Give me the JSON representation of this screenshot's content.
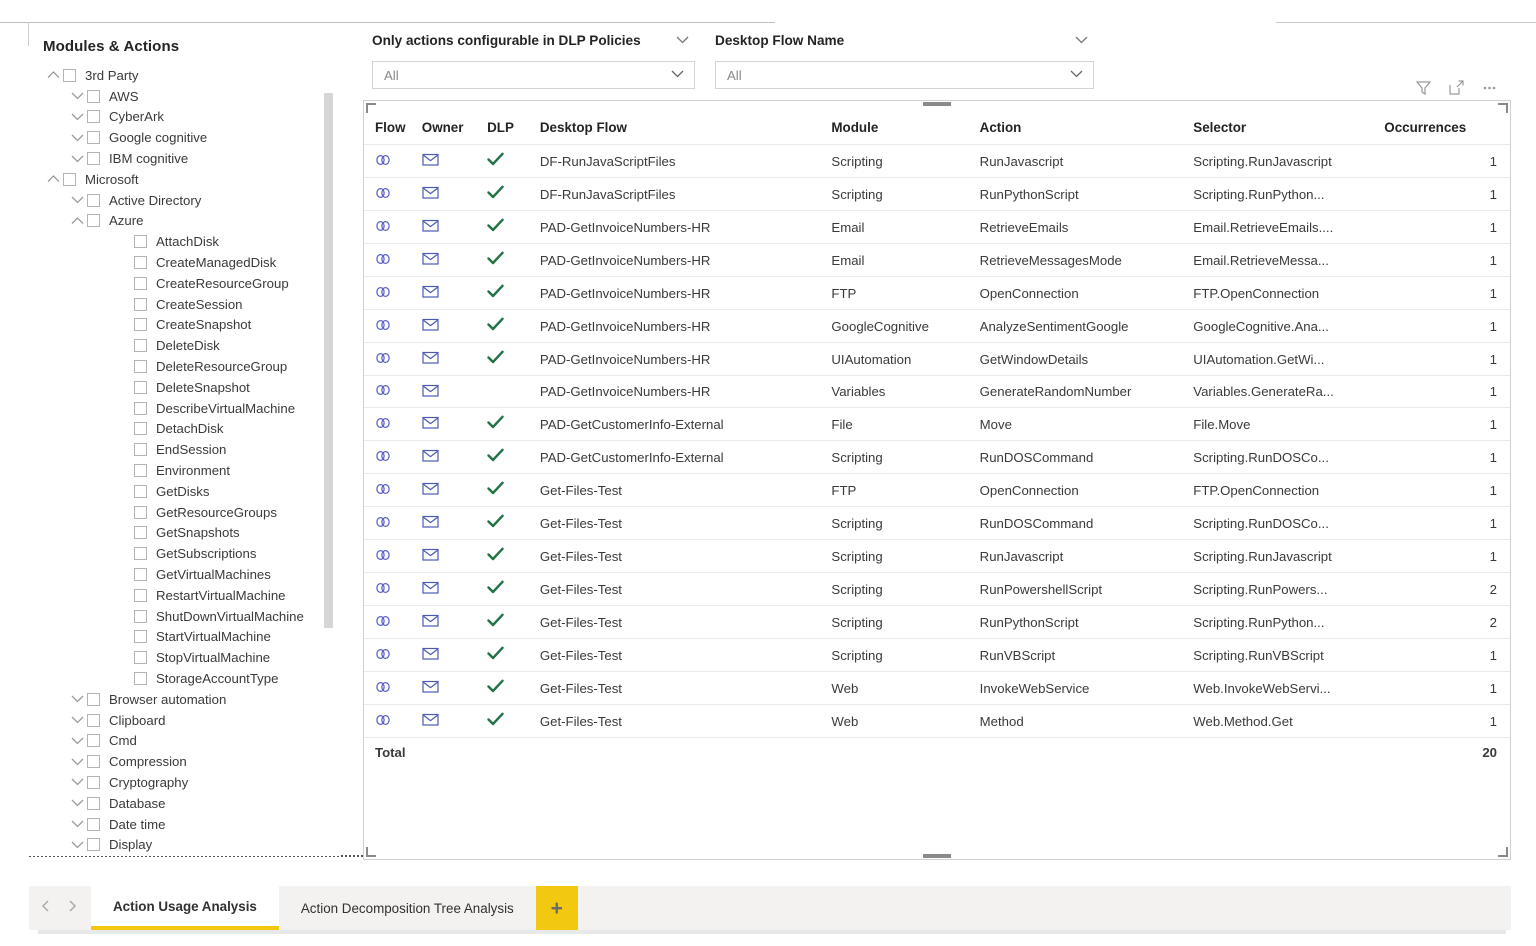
{
  "slicers": {
    "dlp": {
      "title": "Only actions configurable in DLP Policies",
      "value": "All",
      "caret_icon": "chevron-down-icon"
    },
    "flow": {
      "title": "Desktop Flow Name",
      "value": "All",
      "caret_icon": "chevron-down-icon"
    }
  },
  "tree": {
    "title": "Modules & Actions",
    "items": [
      {
        "label": "3rd Party",
        "level": 0,
        "chevron": "chevron-up-icon",
        "checkbox": true
      },
      {
        "label": "AWS",
        "level": 1,
        "chevron": "chevron-down-icon",
        "checkbox": true
      },
      {
        "label": "CyberArk",
        "level": 1,
        "chevron": "chevron-down-icon",
        "checkbox": true
      },
      {
        "label": "Google cognitive",
        "level": 1,
        "chevron": "chevron-down-icon",
        "checkbox": true
      },
      {
        "label": "IBM cognitive",
        "level": 1,
        "chevron": "chevron-down-icon",
        "checkbox": true
      },
      {
        "label": "Microsoft",
        "level": 0,
        "chevron": "chevron-up-icon",
        "checkbox": true
      },
      {
        "label": "Active Directory",
        "level": 1,
        "chevron": "chevron-down-icon",
        "checkbox": true
      },
      {
        "label": "Azure",
        "level": 1,
        "chevron": "chevron-up-icon",
        "checkbox": true
      },
      {
        "label": "AttachDisk",
        "level": 2,
        "chevron": "none",
        "checkbox": true
      },
      {
        "label": "CreateManagedDisk",
        "level": 2,
        "chevron": "none",
        "checkbox": true
      },
      {
        "label": "CreateResourceGroup",
        "level": 2,
        "chevron": "none",
        "checkbox": true
      },
      {
        "label": "CreateSession",
        "level": 2,
        "chevron": "none",
        "checkbox": true
      },
      {
        "label": "CreateSnapshot",
        "level": 2,
        "chevron": "none",
        "checkbox": true
      },
      {
        "label": "DeleteDisk",
        "level": 2,
        "chevron": "none",
        "checkbox": true
      },
      {
        "label": "DeleteResourceGroup",
        "level": 2,
        "chevron": "none",
        "checkbox": true
      },
      {
        "label": "DeleteSnapshot",
        "level": 2,
        "chevron": "none",
        "checkbox": true
      },
      {
        "label": "DescribeVirtualMachine",
        "level": 2,
        "chevron": "none",
        "checkbox": true
      },
      {
        "label": "DetachDisk",
        "level": 2,
        "chevron": "none",
        "checkbox": true
      },
      {
        "label": "EndSession",
        "level": 2,
        "chevron": "none",
        "checkbox": true
      },
      {
        "label": "Environment",
        "level": 2,
        "chevron": "none",
        "checkbox": true
      },
      {
        "label": "GetDisks",
        "level": 2,
        "chevron": "none",
        "checkbox": true
      },
      {
        "label": "GetResourceGroups",
        "level": 2,
        "chevron": "none",
        "checkbox": true
      },
      {
        "label": "GetSnapshots",
        "level": 2,
        "chevron": "none",
        "checkbox": true
      },
      {
        "label": "GetSubscriptions",
        "level": 2,
        "chevron": "none",
        "checkbox": true
      },
      {
        "label": "GetVirtualMachines",
        "level": 2,
        "chevron": "none",
        "checkbox": true
      },
      {
        "label": "RestartVirtualMachine",
        "level": 2,
        "chevron": "none",
        "checkbox": true
      },
      {
        "label": "ShutDownVirtualMachine",
        "level": 2,
        "chevron": "none",
        "checkbox": true
      },
      {
        "label": "StartVirtualMachine",
        "level": 2,
        "chevron": "none",
        "checkbox": true
      },
      {
        "label": "StopVirtualMachine",
        "level": 2,
        "chevron": "none",
        "checkbox": true
      },
      {
        "label": "StorageAccountType",
        "level": 2,
        "chevron": "none",
        "checkbox": true
      },
      {
        "label": "Browser automation",
        "level": 1,
        "chevron": "chevron-down-icon",
        "checkbox": true
      },
      {
        "label": "Clipboard",
        "level": 1,
        "chevron": "chevron-down-icon",
        "checkbox": true
      },
      {
        "label": "Cmd",
        "level": 1,
        "chevron": "chevron-down-icon",
        "checkbox": true
      },
      {
        "label": "Compression",
        "level": 1,
        "chevron": "chevron-down-icon",
        "checkbox": true
      },
      {
        "label": "Cryptography",
        "level": 1,
        "chevron": "chevron-down-icon",
        "checkbox": true
      },
      {
        "label": "Database",
        "level": 1,
        "chevron": "chevron-down-icon",
        "checkbox": true
      },
      {
        "label": "Date time",
        "level": 1,
        "chevron": "chevron-down-icon",
        "checkbox": true
      },
      {
        "label": "Display",
        "level": 1,
        "chevron": "chevron-down-icon",
        "checkbox": true
      }
    ]
  },
  "visual": {
    "header_icons": [
      {
        "name": "filter-icon"
      },
      {
        "name": "focus-mode-icon"
      },
      {
        "name": "more-options-icon"
      }
    ],
    "sort_column": "Flow",
    "sort_direction": "ascending",
    "columns": [
      "Flow",
      "Owner",
      "DLP",
      "Desktop Flow",
      "Module",
      "Action",
      "Selector",
      "Occurrences"
    ],
    "rows": [
      {
        "flow_icon": "flow-link-icon",
        "owner_icon": "envelope-icon",
        "dlp": true,
        "desktop_flow": "DF-RunJavaScriptFiles",
        "module": "Scripting",
        "action": "RunJavascript",
        "selector": "Scripting.RunJavascript",
        "occurrences": "1"
      },
      {
        "flow_icon": "flow-link-icon",
        "owner_icon": "envelope-icon",
        "dlp": true,
        "desktop_flow": "DF-RunJavaScriptFiles",
        "module": "Scripting",
        "action": "RunPythonScript",
        "selector": "Scripting.RunPython...",
        "occurrences": "1"
      },
      {
        "flow_icon": "flow-link-icon",
        "owner_icon": "envelope-icon",
        "dlp": true,
        "desktop_flow": "PAD-GetInvoiceNumbers-HR",
        "module": "Email",
        "action": "RetrieveEmails",
        "selector": "Email.RetrieveEmails....",
        "occurrences": "1"
      },
      {
        "flow_icon": "flow-link-icon",
        "owner_icon": "envelope-icon",
        "dlp": true,
        "desktop_flow": "PAD-GetInvoiceNumbers-HR",
        "module": "Email",
        "action": "RetrieveMessagesMode",
        "selector": "Email.RetrieveMessa...",
        "occurrences": "1"
      },
      {
        "flow_icon": "flow-link-icon",
        "owner_icon": "envelope-icon",
        "dlp": true,
        "desktop_flow": "PAD-GetInvoiceNumbers-HR",
        "module": "FTP",
        "action": "OpenConnection",
        "selector": "FTP.OpenConnection",
        "occurrences": "1"
      },
      {
        "flow_icon": "flow-link-icon",
        "owner_icon": "envelope-icon",
        "dlp": true,
        "desktop_flow": "PAD-GetInvoiceNumbers-HR",
        "module": "GoogleCognitive",
        "action": "AnalyzeSentimentGoogle",
        "selector": "GoogleCognitive.Ana...",
        "occurrences": "1"
      },
      {
        "flow_icon": "flow-link-icon",
        "owner_icon": "envelope-icon",
        "dlp": true,
        "desktop_flow": "PAD-GetInvoiceNumbers-HR",
        "module": "UIAutomation",
        "action": "GetWindowDetails",
        "selector": "UIAutomation.GetWi...",
        "occurrences": "1"
      },
      {
        "flow_icon": "flow-link-icon",
        "owner_icon": "envelope-icon",
        "dlp": false,
        "desktop_flow": "PAD-GetInvoiceNumbers-HR",
        "module": "Variables",
        "action": "GenerateRandomNumber",
        "selector": "Variables.GenerateRa...",
        "occurrences": "1"
      },
      {
        "flow_icon": "flow-link-icon",
        "owner_icon": "envelope-icon",
        "dlp": true,
        "desktop_flow": "PAD-GetCustomerInfo-External",
        "module": "File",
        "action": "Move",
        "selector": "File.Move",
        "occurrences": "1"
      },
      {
        "flow_icon": "flow-link-icon",
        "owner_icon": "envelope-icon",
        "dlp": true,
        "desktop_flow": "PAD-GetCustomerInfo-External",
        "module": "Scripting",
        "action": "RunDOSCommand",
        "selector": "Scripting.RunDOSCo...",
        "occurrences": "1"
      },
      {
        "flow_icon": "flow-link-icon",
        "owner_icon": "envelope-icon",
        "dlp": true,
        "desktop_flow": "Get-Files-Test",
        "module": "FTP",
        "action": "OpenConnection",
        "selector": "FTP.OpenConnection",
        "occurrences": "1"
      },
      {
        "flow_icon": "flow-link-icon",
        "owner_icon": "envelope-icon",
        "dlp": true,
        "desktop_flow": "Get-Files-Test",
        "module": "Scripting",
        "action": "RunDOSCommand",
        "selector": "Scripting.RunDOSCo...",
        "occurrences": "1"
      },
      {
        "flow_icon": "flow-link-icon",
        "owner_icon": "envelope-icon",
        "dlp": true,
        "desktop_flow": "Get-Files-Test",
        "module": "Scripting",
        "action": "RunJavascript",
        "selector": "Scripting.RunJavascript",
        "occurrences": "1"
      },
      {
        "flow_icon": "flow-link-icon",
        "owner_icon": "envelope-icon",
        "dlp": true,
        "desktop_flow": "Get-Files-Test",
        "module": "Scripting",
        "action": "RunPowershellScript",
        "selector": "Scripting.RunPowers...",
        "occurrences": "2"
      },
      {
        "flow_icon": "flow-link-icon",
        "owner_icon": "envelope-icon",
        "dlp": true,
        "desktop_flow": "Get-Files-Test",
        "module": "Scripting",
        "action": "RunPythonScript",
        "selector": "Scripting.RunPython...",
        "occurrences": "2"
      },
      {
        "flow_icon": "flow-link-icon",
        "owner_icon": "envelope-icon",
        "dlp": true,
        "desktop_flow": "Get-Files-Test",
        "module": "Scripting",
        "action": "RunVBScript",
        "selector": "Scripting.RunVBScript",
        "occurrences": "1"
      },
      {
        "flow_icon": "flow-link-icon",
        "owner_icon": "envelope-icon",
        "dlp": true,
        "desktop_flow": "Get-Files-Test",
        "module": "Web",
        "action": "InvokeWebService",
        "selector": "Web.InvokeWebServi...",
        "occurrences": "1"
      },
      {
        "flow_icon": "flow-link-icon",
        "owner_icon": "envelope-icon",
        "dlp": true,
        "desktop_flow": "Get-Files-Test",
        "module": "Web",
        "action": "Method",
        "selector": "Web.Method.Get",
        "occurrences": "1"
      }
    ],
    "total_label": "Total",
    "total_value": "20"
  },
  "tabbar": {
    "prev_icon": "chevron-left-icon",
    "next_icon": "chevron-right-icon",
    "tabs": [
      {
        "label": "Action Usage Analysis",
        "active": true
      },
      {
        "label": "Action Decomposition Tree Analysis",
        "active": false
      }
    ],
    "add_label": "+"
  },
  "colors": {
    "accent": "#F2C811",
    "dlp_check": "#217346",
    "flow_icon": "#5b5fc7",
    "owner_icon": "#4a5ab5",
    "text": "#252423"
  }
}
